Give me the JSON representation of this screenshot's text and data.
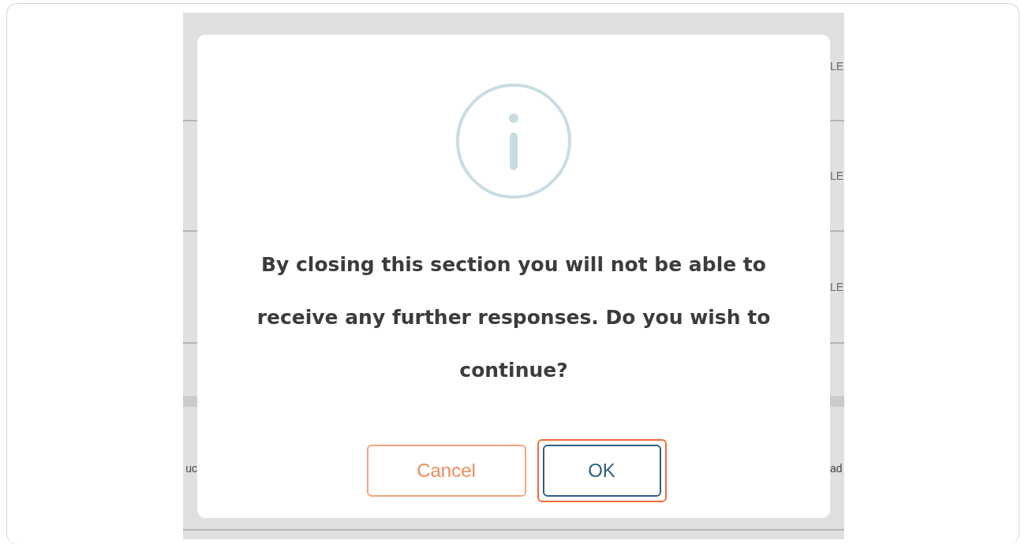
{
  "background": {
    "rows": [
      {
        "left": "",
        "right": "LE"
      },
      {
        "left": "",
        "right": "LE"
      },
      {
        "left": "",
        "right": "LE"
      }
    ],
    "footer_row": {
      "left": "uc",
      "right": "ad"
    }
  },
  "dialog": {
    "message": "By closing this section you will not be able to receive any further responses. Do you wish to continue?",
    "buttons": [
      {
        "label": "Cancel",
        "kind": "secondary",
        "focused": false
      },
      {
        "label": "OK",
        "kind": "primary",
        "focused": true
      }
    ]
  }
}
